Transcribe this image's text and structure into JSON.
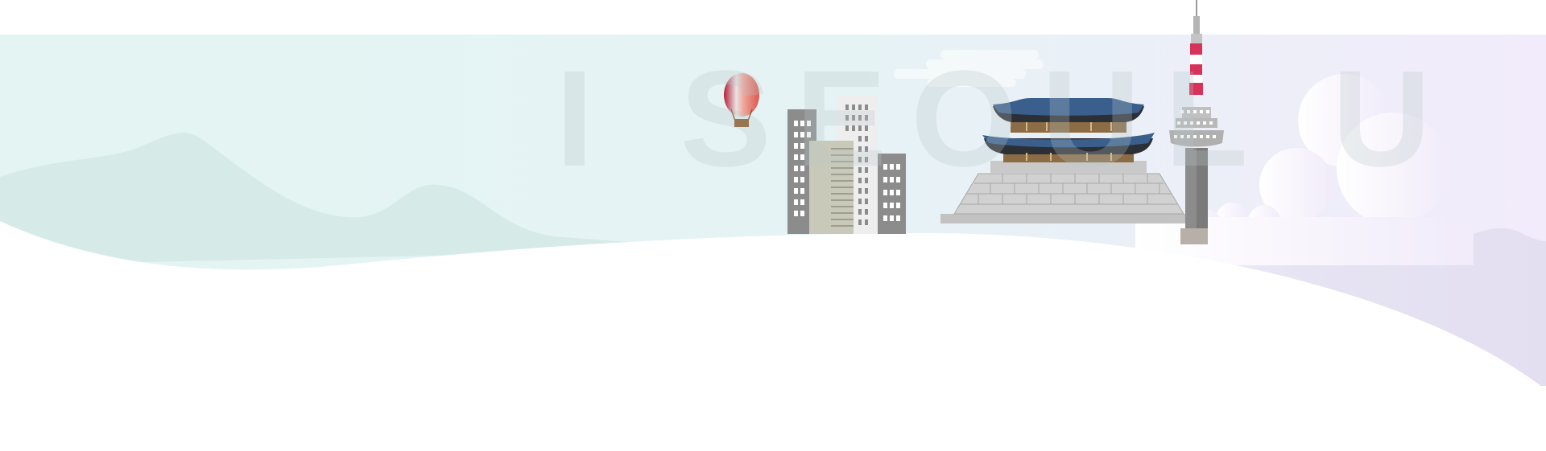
{
  "banner": {
    "watermark_text": "I SEOUL U",
    "colors": {
      "sky_left": "#e3f4f2",
      "sky_right": "#f2ebfb",
      "hills_left": "#d5ebe7",
      "hills_right": "#e6e3f3",
      "ground": "#ffffff",
      "roof_blue": "#3a5f8d",
      "roof_dark": "#2c2f36",
      "tower_red": "#d6325a",
      "building_grey": "#8c8c8c"
    },
    "icons": [
      "hot-air-balloon-icon",
      "city-buildings-icon",
      "palace-gate-icon",
      "seoul-tower-icon",
      "cloud-icon"
    ]
  }
}
